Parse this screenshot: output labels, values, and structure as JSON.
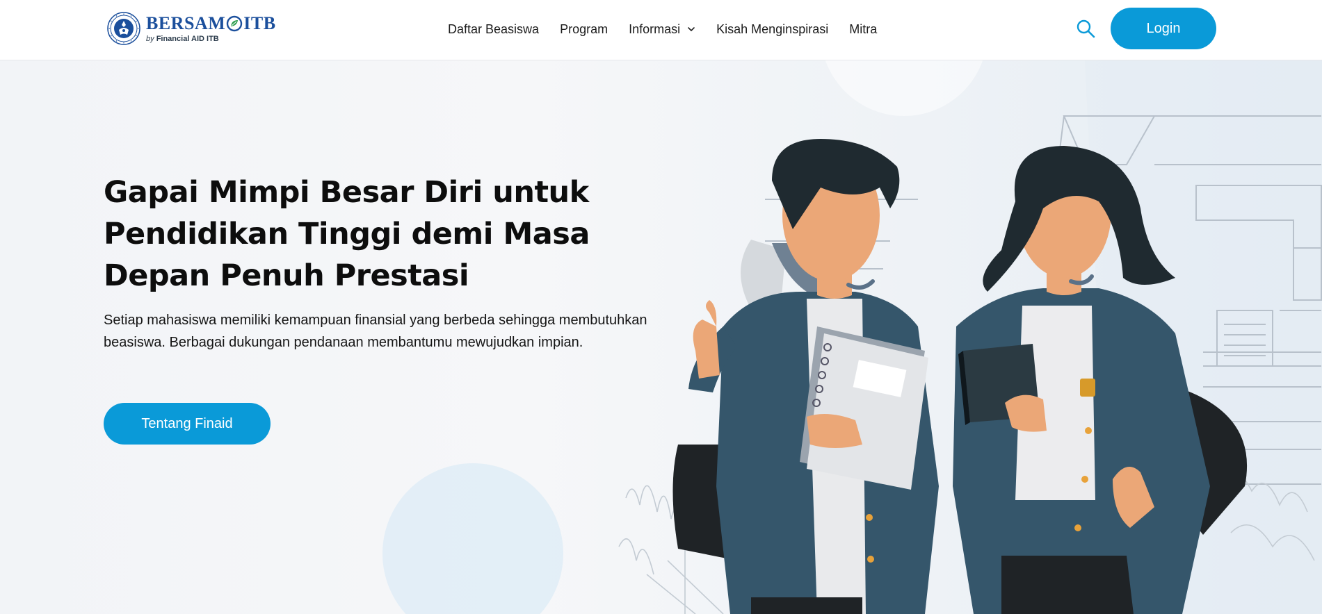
{
  "brand": {
    "name_left": "BERSAM",
    "name_right": "ITB",
    "tagline_prefix": "by",
    "tagline": "Financial AID ITB",
    "seal_icon": "itb-seal-icon",
    "color": "#1b4f9c",
    "accent": "#2e9e4f"
  },
  "nav": {
    "items": [
      {
        "label": "Daftar Beasiswa"
      },
      {
        "label": "Program"
      },
      {
        "label": "Informasi",
        "has_dropdown": true
      },
      {
        "label": "Kisah Menginspirasi"
      },
      {
        "label": "Mitra"
      }
    ],
    "search_icon": "search-icon",
    "login_label": "Login"
  },
  "hero": {
    "title": "Gapai Mimpi Besar Diri untuk Pendidikan Tinggi demi Masa Depan Penuh Prestasi",
    "description": "Setiap mahasiswa memiliki kemampuan finansial yang berbeda sehingga membutuhkan beasiswa. Berbagai dukungan pendanaan membantumu mewujudkan impian.",
    "cta_label": "Tentang Finaid",
    "illustration": "two-students-with-books-illustration"
  },
  "colors": {
    "primary": "#0a9ad8",
    "jacket": "#35566b",
    "skin": "#eba777",
    "hair": "#1f2a30"
  }
}
